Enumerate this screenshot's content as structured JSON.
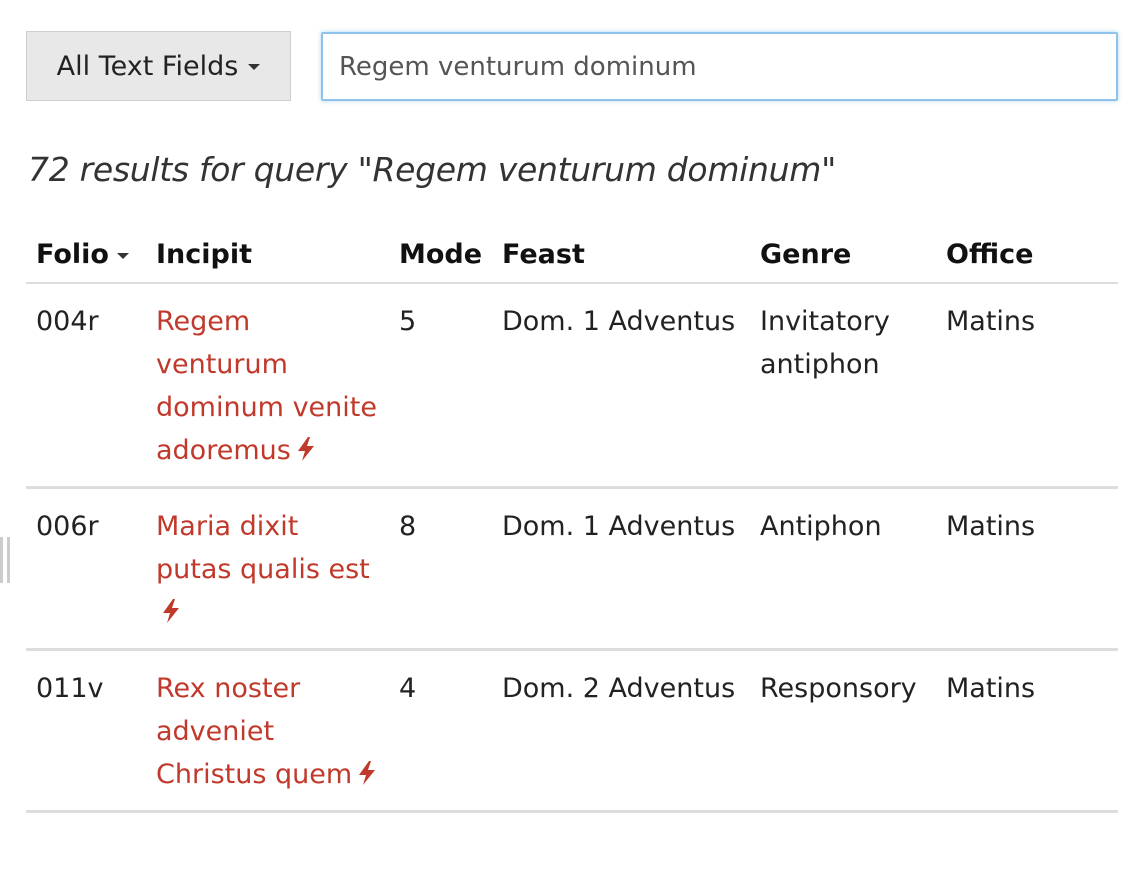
{
  "search": {
    "field_select_label": "All Text Fields",
    "query_value": "Regem venturum dominum"
  },
  "results_summary": "72 results for query \"Regem venturum dominum\"",
  "table": {
    "columns": [
      "Folio",
      "Incipit",
      "Mode",
      "Feast",
      "Genre",
      "Office"
    ],
    "sorted_column": "Folio",
    "rows": [
      {
        "folio": "004r",
        "incipit": "Regem venturum dominum venite adoremus",
        "mode": "5",
        "feast": "Dom. 1 Adventus",
        "genre": "Invitatory antiphon",
        "office": "Matins"
      },
      {
        "folio": "006r",
        "incipit": "Maria dixit putas qualis est",
        "mode": "8",
        "feast": "Dom. 1 Adventus",
        "genre": "Antiphon",
        "office": "Matins"
      },
      {
        "folio": "011v",
        "incipit": "Rex noster adveniet Christus quem",
        "mode": "4",
        "feast": "Dom. 2 Adventus",
        "genre": "Responsory",
        "office": "Matins"
      }
    ]
  },
  "colors": {
    "link": "#c0392b",
    "focus_border": "#8fc3ea",
    "select_bg": "#e8e8e8",
    "divider": "#dddddd"
  },
  "icons": {
    "incipit_marker": "lightning-bolt-icon",
    "dropdown": "caret-down-icon"
  }
}
